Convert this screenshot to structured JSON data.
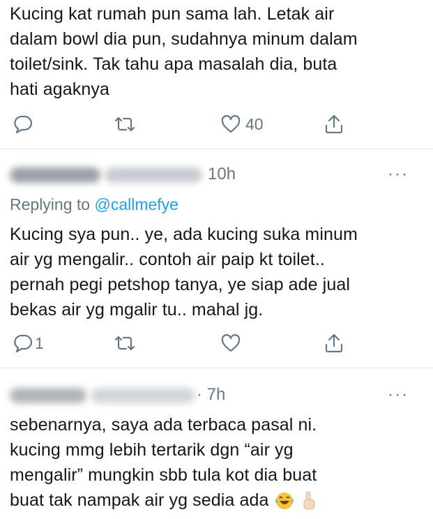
{
  "tweets": [
    {
      "lines": [
        "Kucing kat rumah pun sama lah. Letak air",
        "dalam bowl dia pun, sudahnya minum dalam",
        "toilet/sink. Tak tahu apa masalah dia, buta",
        "hati agaknya"
      ],
      "reply_count": "",
      "like_count": "40"
    },
    {
      "time": "10h",
      "more": "···",
      "replying_prefix": "Replying to ",
      "replying_handle": "@callmefye",
      "lines": [
        "Kucing sya pun.. ye, ada kucing suka minum",
        "air yg mengalir.. contoh air paip kt toilet..",
        "pernah pegi petshop tanya, ye siap ade jual",
        "bekas air yg mgalir tu.. mahal jg."
      ],
      "reply_count": "1",
      "like_count": ""
    },
    {
      "time": "· 7h",
      "more": "···",
      "lines": [
        "sebenarnya, saya ada terbaca pasal ni.",
        "kucing mmg lebih tertarik dgn “air yg",
        "mengalir” mungkin sbb tula kot dia buat",
        "buat tak nampak air yg sedia ada"
      ],
      "emojis": [
        "laughing-tears-emoji",
        "pointing-up-emoji"
      ]
    }
  ],
  "colors": {
    "text": "#14171a",
    "secondary": "#657786",
    "link": "#1da1f2",
    "divider": "#e1e8ed"
  }
}
